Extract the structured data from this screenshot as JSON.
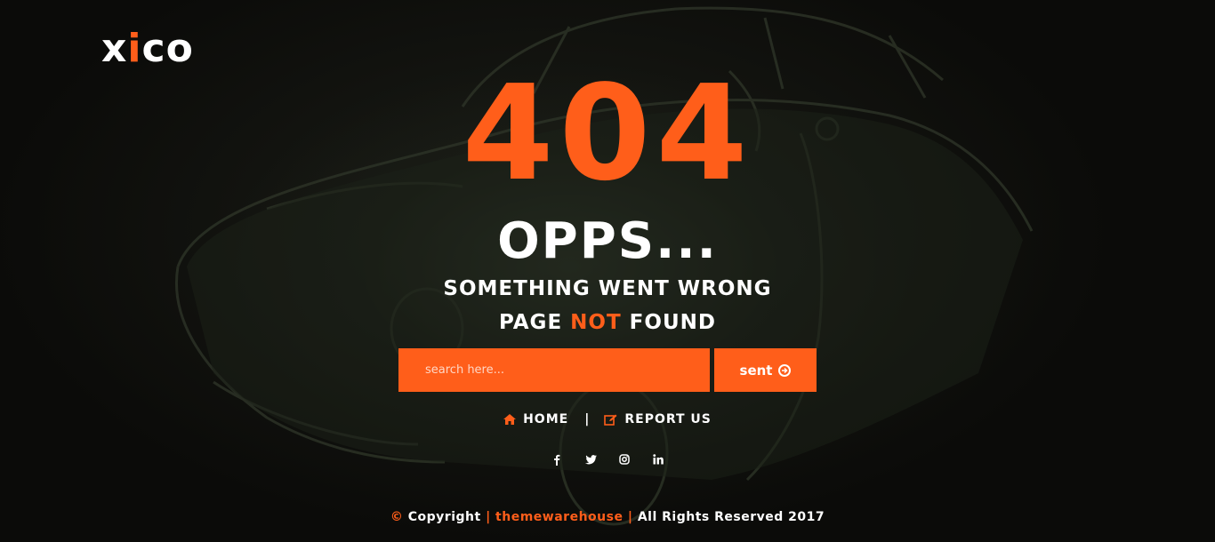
{
  "brand": {
    "logo_prefix": "x",
    "logo_accent": "i",
    "logo_suffix": "co"
  },
  "hero": {
    "code": "404",
    "headline": "OPPS...",
    "subline1": "SOMETHING WENT WRONG",
    "subline2_prefix": "PAGE ",
    "subline2_highlight": "NOT",
    "subline2_suffix": " FOUND"
  },
  "search": {
    "placeholder": "search here...",
    "value": "",
    "button_label": "sent"
  },
  "nav": {
    "home_label": "HOME",
    "separator": "|",
    "report_label": "REPORT US"
  },
  "social": [
    {
      "name": "facebook-icon",
      "glyph": "f"
    },
    {
      "name": "twitter-icon",
      "glyph": "twitter"
    },
    {
      "name": "instagram-icon",
      "glyph": "instagram"
    },
    {
      "name": "linkedin-icon",
      "glyph": "in"
    }
  ],
  "footer": {
    "copyright_symbol": "©",
    "copyright_label": " Copyright ",
    "sep1": "|",
    "company": " themewarehouse ",
    "sep2": "|",
    "rights": " All Rights Reserved 2017"
  },
  "colors": {
    "accent": "#ff5e1a",
    "background": "#0b0b09",
    "text": "#ffffff"
  }
}
